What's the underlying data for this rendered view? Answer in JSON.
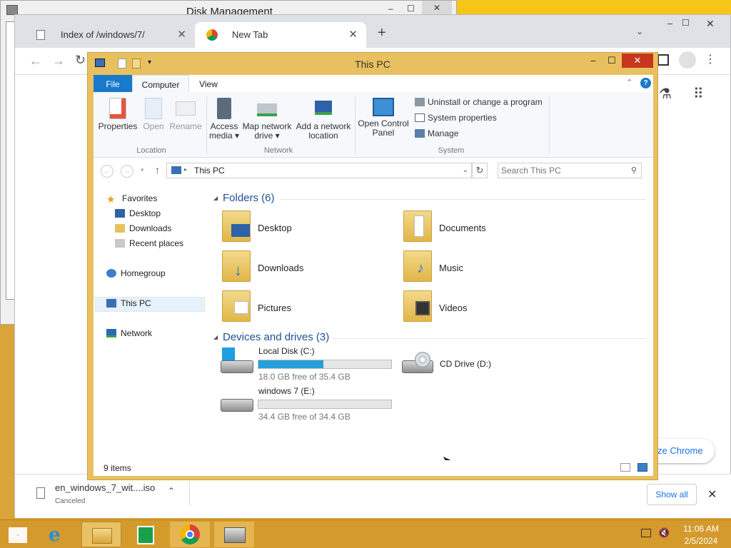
{
  "bg_window": {
    "title": "Disk Management",
    "min": "–",
    "max": "☐",
    "close": "✕"
  },
  "chrome": {
    "tabs": [
      {
        "label": "Index of /windows/7/"
      },
      {
        "label": "New Tab"
      }
    ],
    "new_tab": "+",
    "side_text": "ze Chrome",
    "download": {
      "filename": "en_windows_7_wit....iso",
      "status": "Canceled",
      "show_all": "Show all"
    }
  },
  "explorer": {
    "title": "This PC",
    "ribbon_tabs": [
      "File",
      "Computer",
      "View"
    ],
    "buttons": {
      "properties": "Properties",
      "open": "Open",
      "rename": "Rename",
      "access_media": "Access media ▾",
      "map_drive": "Map network drive ▾",
      "add_location": "Add a network location",
      "open_cp": "Open Control Panel",
      "uninstall": "Uninstall or change a program",
      "system_props": "System properties",
      "manage": "Manage"
    },
    "groups": [
      "Location",
      "Network",
      "System"
    ],
    "address": "This PC",
    "search_placeholder": "Search This PC",
    "nav": {
      "favorites": "Favorites",
      "desktop": "Desktop",
      "downloads": "Downloads",
      "recent": "Recent places",
      "homegroup": "Homegroup",
      "thispc": "This PC",
      "network": "Network"
    },
    "folders_header": "Folders (6)",
    "folders": [
      "Desktop",
      "Documents",
      "Downloads",
      "Music",
      "Pictures",
      "Videos"
    ],
    "devices_header": "Devices and drives (3)",
    "drives": [
      {
        "name": "Local Disk (C:)",
        "free": "18.0 GB free of 35.4 GB",
        "used_fraction": 0.49
      },
      {
        "name": "windows 7 (E:)",
        "free": "34.4 GB free of 34.4 GB",
        "used_fraction": 0.0
      }
    ],
    "cd_drive": "CD Drive (D:)",
    "status": "9 items",
    "accent": "#1979ca"
  },
  "taskbar": {
    "time": "11:06 AM",
    "date": "2/5/2024"
  }
}
